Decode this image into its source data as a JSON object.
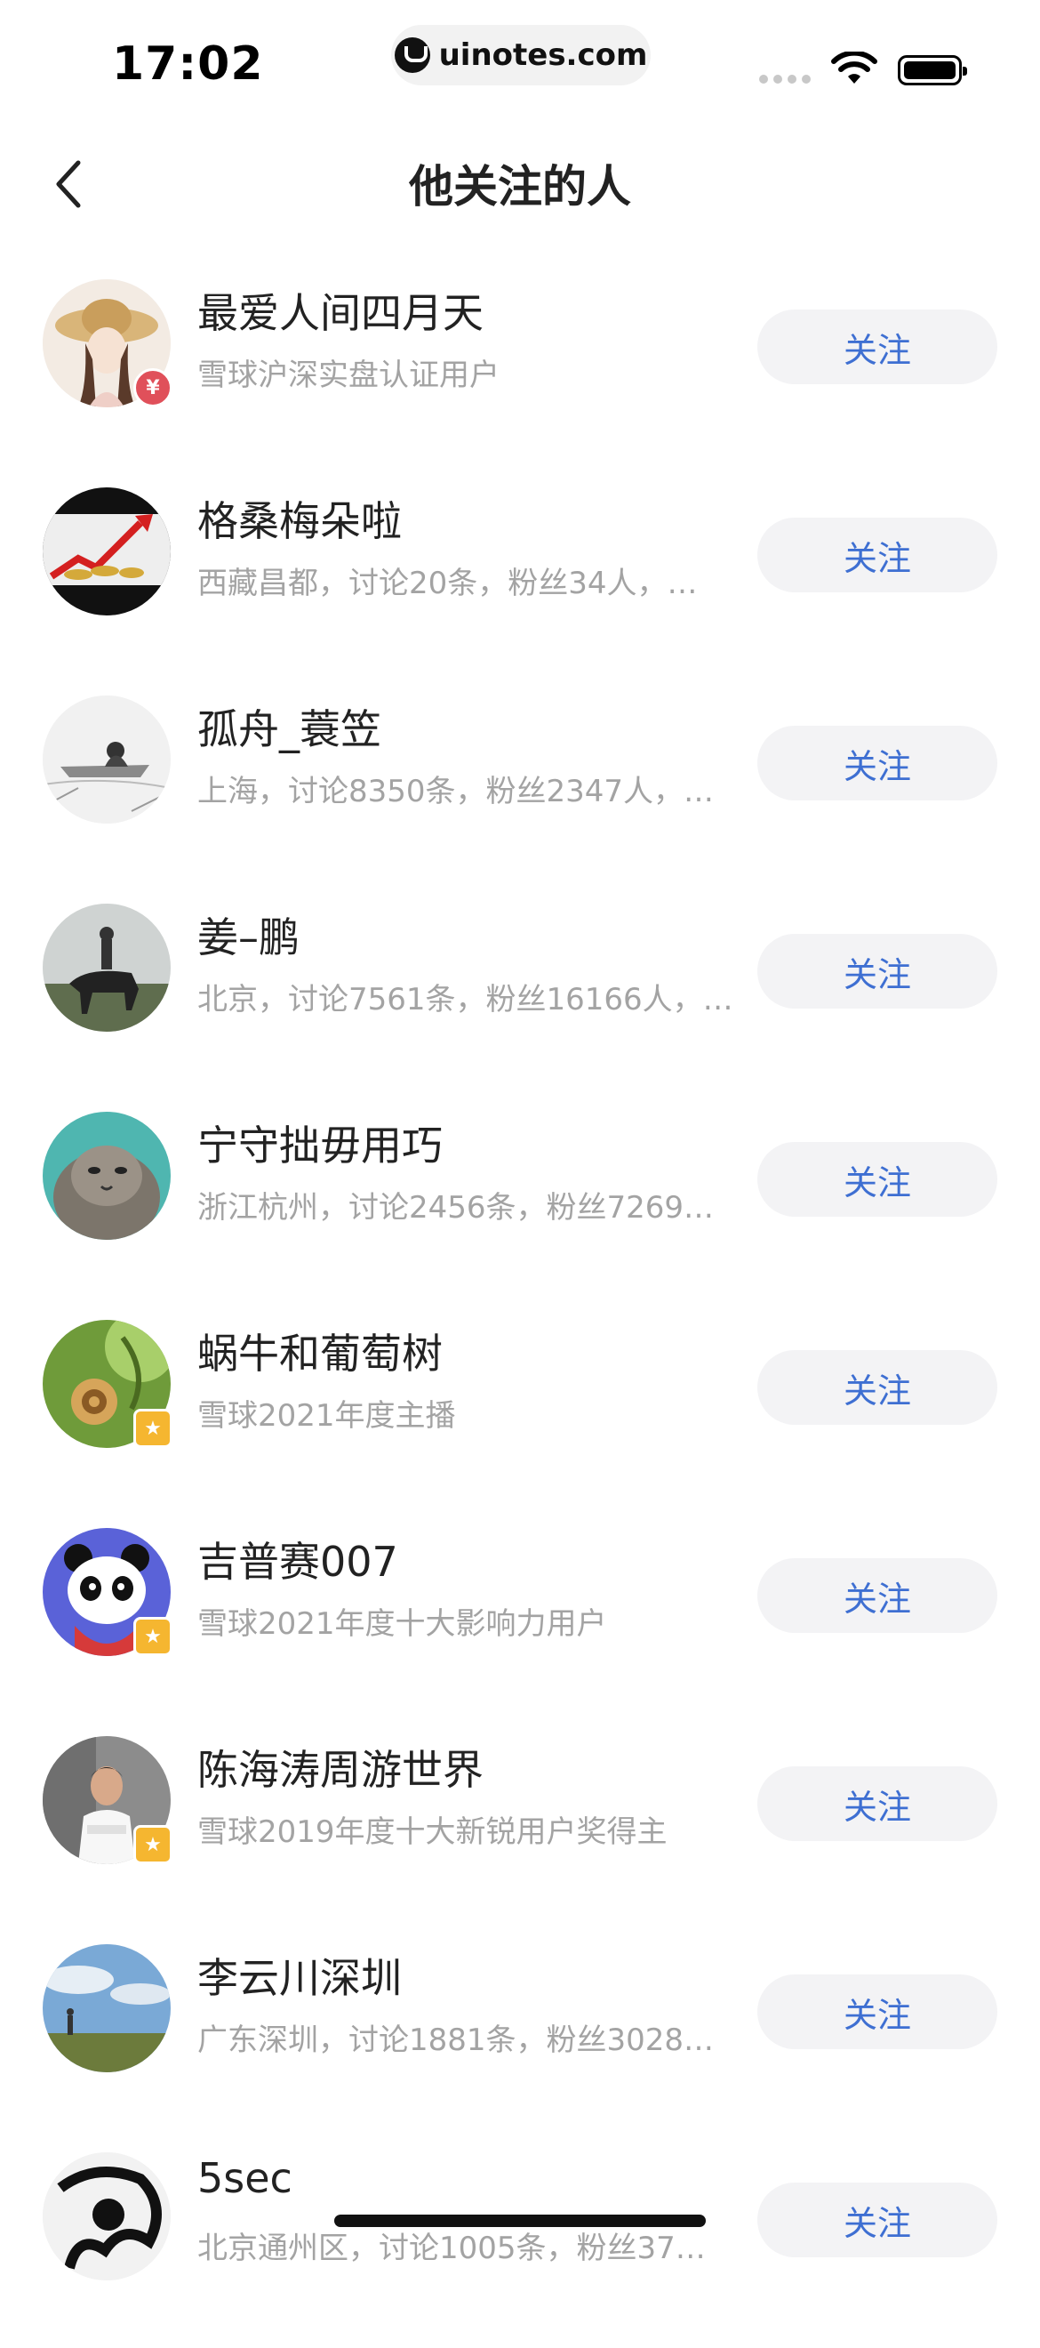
{
  "status_bar": {
    "time": "17:02",
    "url": "uinotes.com",
    "icons": [
      "signal-icon",
      "wifi-icon",
      "battery-icon"
    ]
  },
  "nav": {
    "title": "他关注的人",
    "back_icon": "chevron-left-icon"
  },
  "colors": {
    "follow_text": "#3e6fd2",
    "follow_bg": "#f3f3f5",
    "desc_text": "#a3a3a3"
  },
  "users": [
    {
      "name": "最爱人间四月天",
      "desc": "雪球沪深实盘认证用户",
      "badge": "yuan-badge",
      "button": "关注"
    },
    {
      "name": "格桑梅朵啦",
      "desc": "西藏昌都，讨论20条，粉丝34人，…",
      "badge": "",
      "button": "关注"
    },
    {
      "name": "孤舟_蓑笠",
      "desc": "上海，讨论8350条，粉丝2347人，…",
      "badge": "",
      "button": "关注"
    },
    {
      "name": "姜–鹏",
      "desc": "北京，讨论7561条，粉丝16166人，…",
      "badge": "",
      "button": "关注"
    },
    {
      "name": "宁守拙毋用巧",
      "desc": "浙江杭州，讨论2456条，粉丝7269…",
      "badge": "",
      "button": "关注"
    },
    {
      "name": "蜗牛和葡萄树",
      "desc": "雪球2021年度主播",
      "badge": "star-badge",
      "button": "关注"
    },
    {
      "name": "吉普赛007",
      "desc": "雪球2021年度十大影响力用户",
      "badge": "star-badge",
      "button": "关注"
    },
    {
      "name": "陈海涛周游世界",
      "desc": "雪球2019年度十大新锐用户奖得主",
      "badge": "star-badge",
      "button": "关注"
    },
    {
      "name": "李云川深圳",
      "desc": "广东深圳，讨论1881条，粉丝3028…",
      "badge": "",
      "button": "关注"
    },
    {
      "name": "5sec",
      "desc": "北京通州区，讨论1005条，粉丝37…",
      "badge": "",
      "button": "关注"
    }
  ]
}
